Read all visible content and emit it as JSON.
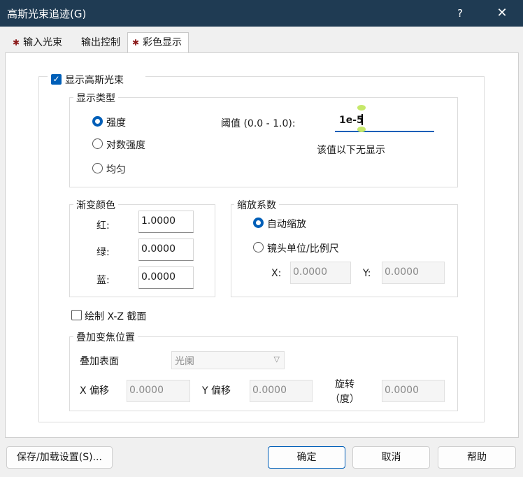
{
  "window": {
    "title": "高斯光束追迹(G)",
    "help_label": "?",
    "close_label": "✕"
  },
  "tabs": [
    {
      "label": "输入光束",
      "marked": true
    },
    {
      "label": "输出控制",
      "marked": false
    },
    {
      "label": "彩色显示",
      "marked": true,
      "active": true
    }
  ],
  "show_gaussian": {
    "label": "显示高斯光束",
    "checked": true
  },
  "display_type": {
    "title": "显示类型",
    "options": [
      "强度",
      "对数强度",
      "均匀"
    ],
    "selected": "强度",
    "threshold_label": "阈值 (0.0 - 1.0):",
    "threshold_value": "1e-5",
    "threshold_note": "该值以下无显示"
  },
  "gradient_color": {
    "title": "渐变颜色",
    "red_label": "红:",
    "red_value": "1.0000",
    "green_label": "绿:",
    "green_value": "0.0000",
    "blue_label": "蓝:",
    "blue_value": "0.0000"
  },
  "scale": {
    "title": "缩放系数",
    "auto_label": "自动缩放",
    "lens_label": "镜头单位/比例尺",
    "selected": "自动缩放",
    "x_label": "X:",
    "x_value": "0.0000",
    "y_label": "Y:",
    "y_value": "0.0000"
  },
  "xz_section": {
    "label": "绘制 X-Z 截面",
    "checked": false
  },
  "overlay_focus": {
    "title": "叠加变焦位置",
    "surface_label": "叠加表面",
    "surface_value": "光阑",
    "x_offset_label": "X 偏移",
    "x_offset_value": "0.0000",
    "y_offset_label": "Y 偏移",
    "y_offset_value": "0.0000",
    "rotation_label_1": "旋转",
    "rotation_label_2": "（度）",
    "rotation_value": "0.0000"
  },
  "buttons": {
    "save_load": "保存/加载设置(S)...",
    "ok": "确定",
    "cancel": "取消",
    "help": "帮助"
  },
  "colors": {
    "titlebar": "#1f3b53",
    "accent": "#005fb8"
  }
}
